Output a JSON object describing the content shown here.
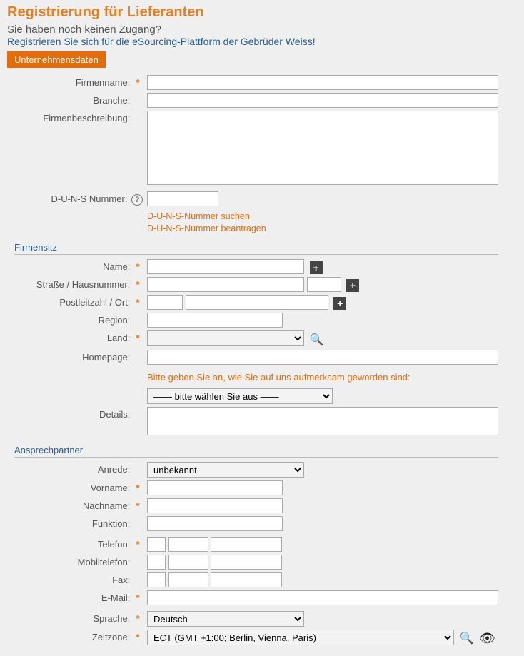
{
  "header": {
    "title": "Registrierung für Lieferanten",
    "subtitle1": "Sie haben noch keinen Zugang?",
    "subtitle2": "Registrieren Sie sich für die eSourcing-Plattform der Gebrüder Weiss!"
  },
  "tab": {
    "label": "Unternehmensdaten"
  },
  "company": {
    "firmenname_label": "Firmenname:",
    "branche_label": "Branche:",
    "firmenbeschreibung_label": "Firmenbeschreibung:",
    "duns_label": "D-U-N-S Nummer:",
    "duns_search_link": "D-U-N-S-Nummer suchen",
    "duns_request_link": "D-U-N-S-Nummer beantragen"
  },
  "firmensitz": {
    "heading": "Firmensitz",
    "name_label": "Name:",
    "strasse_label": "Straße / Hausnummer:",
    "plz_label": "Postleitzahl / Ort:",
    "region_label": "Region:",
    "land_label": "Land:",
    "homepage_label": "Homepage:",
    "awareness_prompt": "Bitte geben Sie an, wie Sie auf uns aufmerksam geworden sind:",
    "awareness_placeholder": "——   bitte wählen Sie aus   ——",
    "details_label": "Details:"
  },
  "ansprechpartner": {
    "heading": "Ansprechpartner",
    "anrede_label": "Anrede:",
    "anrede_value": "unbekannt",
    "vorname_label": "Vorname:",
    "nachname_label": "Nachname:",
    "funktion_label": "Funktion:",
    "telefon_label": "Telefon:",
    "mobil_label": "Mobiltelefon:",
    "fax_label": "Fax:",
    "email_label": "E-Mail:",
    "sprache_label": "Sprache:",
    "sprache_value": "Deutsch",
    "zeitzone_label": "Zeitzone:",
    "zeitzone_value": "ECT (GMT +1:00; Berlin, Vienna, Paris)"
  }
}
